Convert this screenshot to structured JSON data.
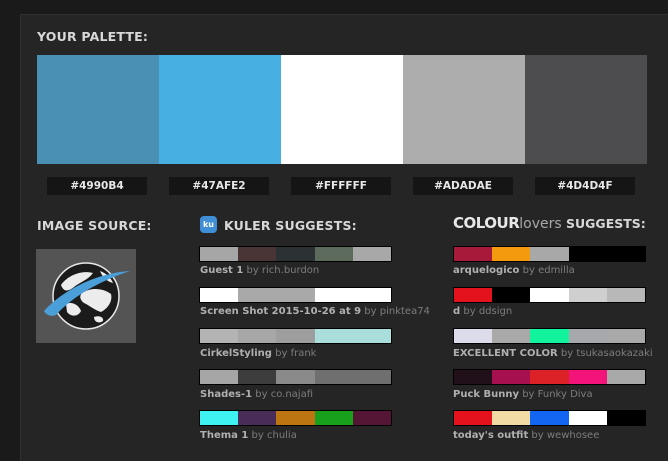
{
  "palette": {
    "heading": "YOUR PALETTE:",
    "colors": [
      {
        "hex": "#4990B4",
        "color": "#4990B4"
      },
      {
        "hex": "#47AFE2",
        "color": "#47AFE2"
      },
      {
        "hex": "#FFFFFF",
        "color": "#FFFFFF"
      },
      {
        "hex": "#ADADAE",
        "color": "#ADADAE"
      },
      {
        "hex": "#4D4D4F",
        "color": "#4D4D4F"
      }
    ]
  },
  "image_source": {
    "heading": "IMAGE SOURCE:"
  },
  "kuler": {
    "icon_text": "ku",
    "heading": "KULER SUGGESTS:",
    "items": [
      {
        "name": "Guest 1",
        "by": "by",
        "author": "rich.burdon",
        "colors": [
          "#a6a6a6",
          "#4a3536",
          "#2c3133",
          "#5d6b5c",
          "#a8a8a8"
        ]
      },
      {
        "name": "Screen Shot 2015-10-26 at 9",
        "by": "by",
        "author": "pinktea74",
        "colors": [
          "#ffffff",
          "#a9a9a9",
          "#a9a9a9",
          "#ffffff",
          "#ffffff"
        ]
      },
      {
        "name": "CirkelStyling",
        "by": "by",
        "author": "frank",
        "colors": [
          "#b3b3b3",
          "#a7a7a7",
          "#9e9e9e",
          "#a9dedd",
          "#a9dedd"
        ]
      },
      {
        "name": "Shades-1",
        "by": "by",
        "author": "co.najafi",
        "colors": [
          "#a6a6a6",
          "#3d3d3d",
          "#8a8a8a",
          "#6f6f6f",
          "#6f6f6f"
        ]
      },
      {
        "name": "Thema 1",
        "by": "by",
        "author": "chulia",
        "colors": [
          "#3ef2f2",
          "#4a2c59",
          "#bc7510",
          "#18a01d",
          "#541634"
        ]
      }
    ]
  },
  "colourlovers": {
    "heading_bold": "COLOUR",
    "heading_light": "lovers",
    "heading_rest": " SUGGESTS:",
    "items": [
      {
        "name": "arquelogico",
        "by": "by",
        "author": "edmilla",
        "colors": [
          "#a81a3a",
          "#f49a0f",
          "#a8a8a8",
          "#000000",
          "#000000"
        ]
      },
      {
        "name": "d",
        "by": "by",
        "author": "ddsign",
        "colors": [
          "#e3121d",
          "#000000",
          "#ffffff",
          "#cfcfcf",
          "#b8b8b8"
        ]
      },
      {
        "name": "EXCELLENT COLOR",
        "by": "by",
        "author": "tsukasaokazaki",
        "colors": [
          "#dcdcec",
          "#a9a9a9",
          "#12f39d",
          "#a7a8ae",
          "#a9a9a9"
        ]
      },
      {
        "name": "Puck Bunny",
        "by": "by",
        "author": "Funky Diva",
        "colors": [
          "#21101a",
          "#a7104f",
          "#dc2226",
          "#f3147a",
          "#a9a9a9"
        ]
      },
      {
        "name": "today's outfit",
        "by": "by",
        "author": "wewhosee",
        "colors": [
          "#e3121d",
          "#f2dba4",
          "#1266f2",
          "#ffffff",
          "#000000"
        ]
      }
    ]
  }
}
